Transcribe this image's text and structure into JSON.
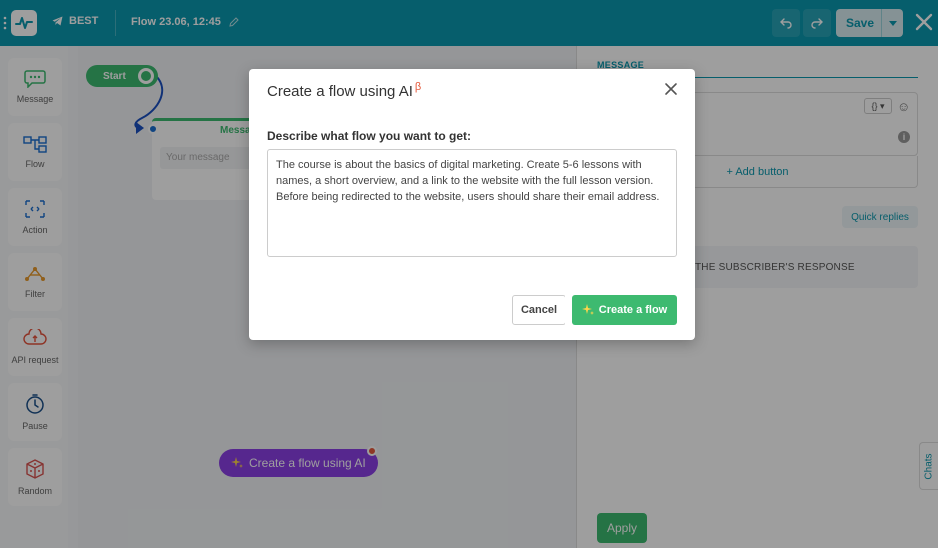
{
  "topbar": {
    "bot_name": "BEST",
    "flow_title": "Flow 23.06, 12:45",
    "save_label": "Save"
  },
  "sidebar": {
    "items": [
      {
        "label": "Message",
        "icon": "message-icon"
      },
      {
        "label": "Flow",
        "icon": "flow-icon"
      },
      {
        "label": "Action",
        "icon": "action-icon"
      },
      {
        "label": "Filter",
        "icon": "filter-icon"
      },
      {
        "label": "API request",
        "icon": "api-request-icon"
      },
      {
        "label": "Pause",
        "icon": "pause-icon"
      },
      {
        "label": "Random",
        "icon": "random-icon"
      }
    ]
  },
  "canvas": {
    "start_label": "Start",
    "node_title": "Messa",
    "node_placeholder": "Your message",
    "ai_pill_label": "Create a flow using AI"
  },
  "right_panel": {
    "tab_label": "MESSAGE",
    "var_button": "{}",
    "add_button_label": "+ Add button",
    "quick_replies_label": "Quick replies",
    "subscriber_response_label": "THE SUBSCRIBER'S RESPONSE",
    "apply_label": "Apply",
    "chats_label": "Chats"
  },
  "modal": {
    "title": "Create a flow using AI",
    "beta_mark": "β",
    "prompt_label": "Describe what flow you want to get:",
    "prompt_text": "The course is about the basics of digital marketing. Create 5-6 lessons with names, a short overview, and a link to the website with the full lesson version. Before being redirected to the website, users should share their email address.",
    "cancel_label": "Cancel",
    "create_label": "Create a flow"
  },
  "colors": {
    "topbar": "#0b98ae",
    "green": "#3dba70",
    "purple": "#8b3fe6",
    "beta": "#e55a3c"
  }
}
